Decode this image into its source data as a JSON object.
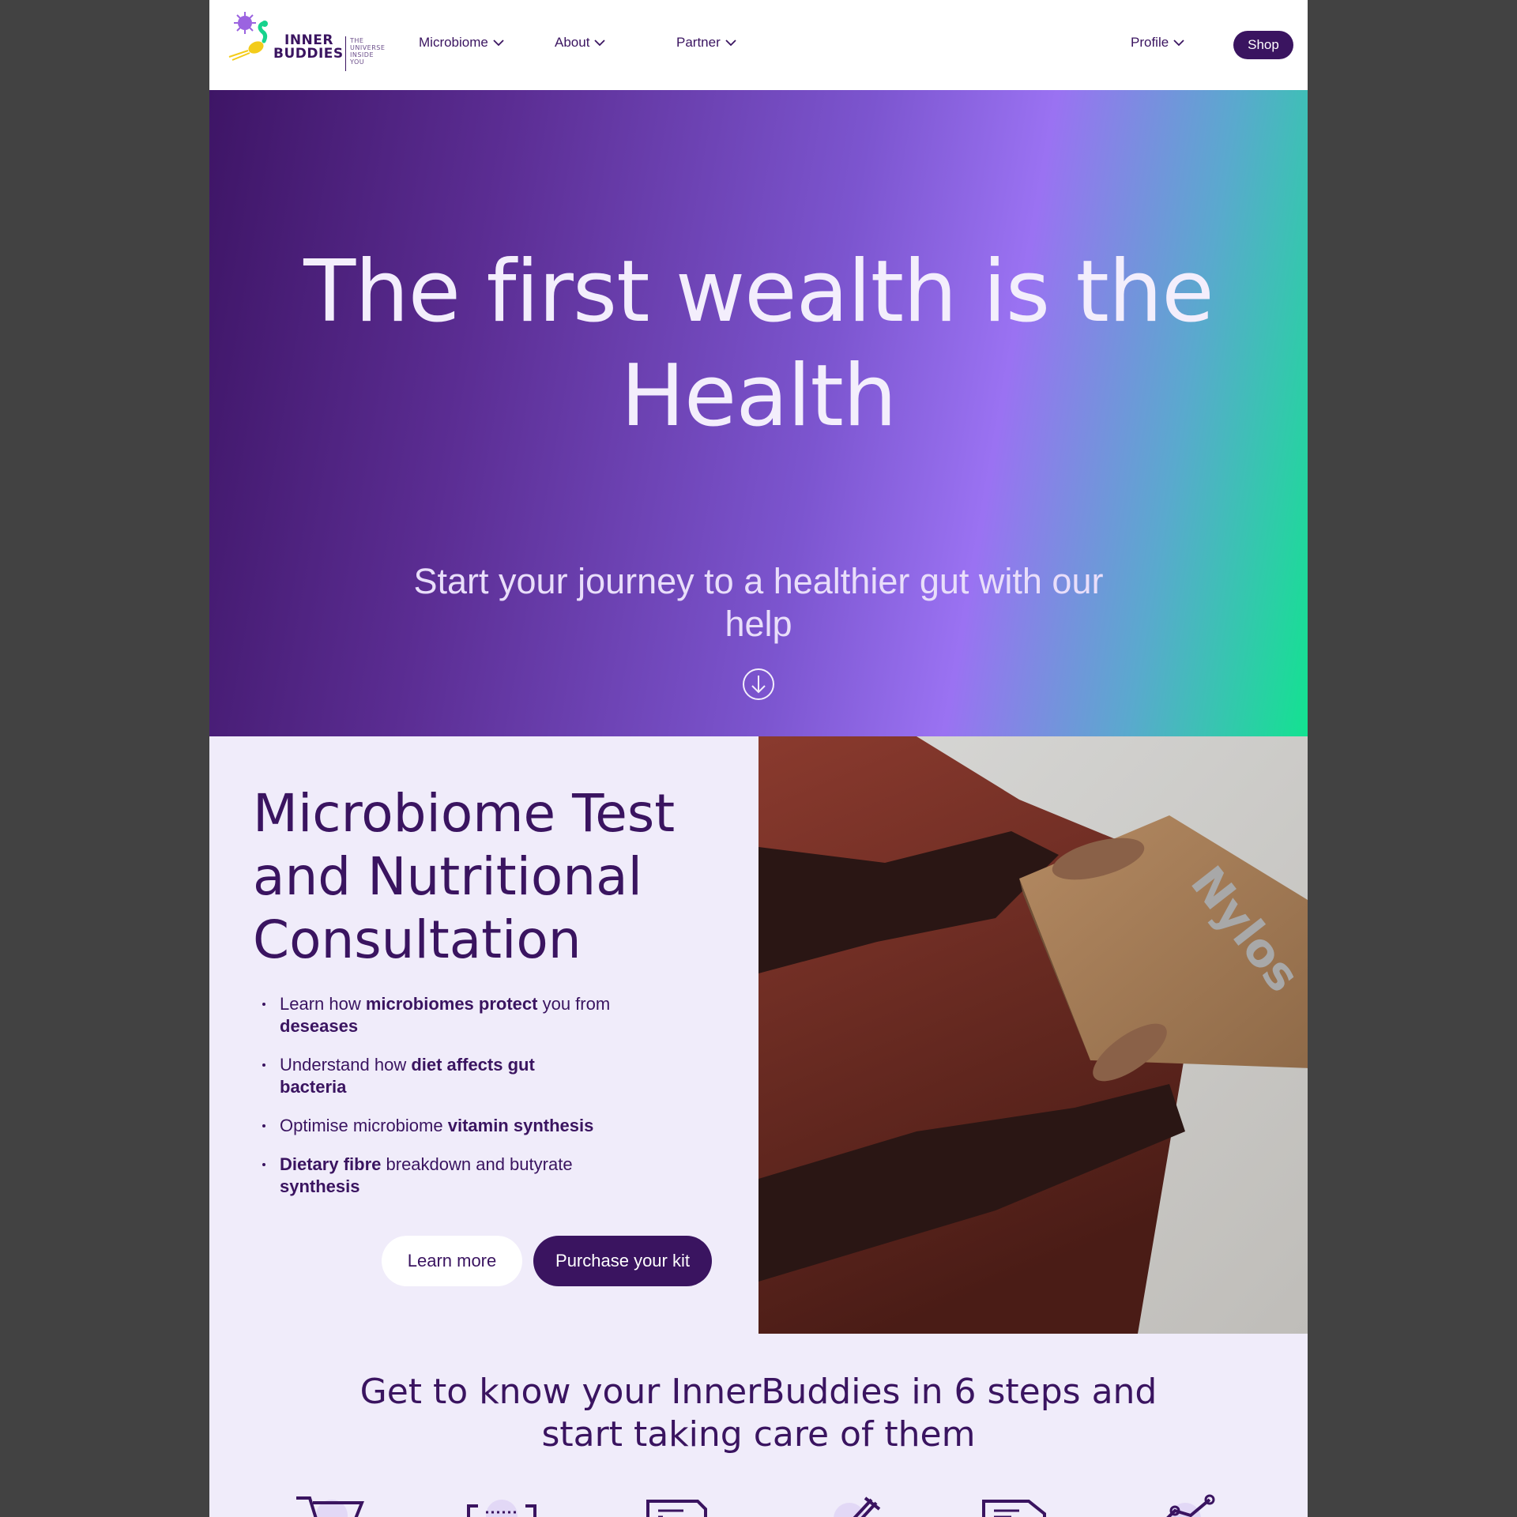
{
  "brand": {
    "name_line1": "INNER",
    "name_line2": "BUDDIES",
    "tagline": [
      "THE",
      "UNIVERSE",
      "INSIDE",
      "YOU"
    ]
  },
  "nav": {
    "items": [
      {
        "label": "Microbiome"
      },
      {
        "label": "About"
      },
      {
        "label": "Partner"
      }
    ],
    "profile": "Profile",
    "shop": "Shop"
  },
  "hero": {
    "title": "The first wealth is the Health",
    "subtitle": "Start your journey to a healthier gut with our help"
  },
  "feature": {
    "title": "Microbiome Test and Nutritional Consultation",
    "bullets": [
      {
        "p1": "Learn how ",
        "b1": "microbiomes protect",
        "p2": " you from ",
        "b2": "deseases"
      },
      {
        "p1": "Understand how ",
        "b1": "diet affects gut bacteria",
        "p2": "",
        "b2": ""
      },
      {
        "p1": "Optimise microbiome ",
        "b1": "vitamin synthesis",
        "p2": "",
        "b2": ""
      },
      {
        "p1": "",
        "b1": "Dietary fibre",
        "p2": " breakdown and butyrate ",
        "b2": "synthesis"
      }
    ],
    "learn_more": "Learn more",
    "purchase": "Purchase your kit",
    "photo_box_text": "Nylos"
  },
  "steps": {
    "title": "Get to know your InnerBuddies in 6 steps and start taking care of them",
    "icons": [
      "cart-icon",
      "kit-box-icon",
      "form-icon",
      "sample-tube-icon",
      "shipping-icon",
      "results-chart-icon"
    ]
  },
  "colors": {
    "primary": "#3a1460",
    "background": "#f0ecfa",
    "page_bg": "#424242",
    "accent_purple": "#9a72f2",
    "accent_green": "#13e291"
  }
}
